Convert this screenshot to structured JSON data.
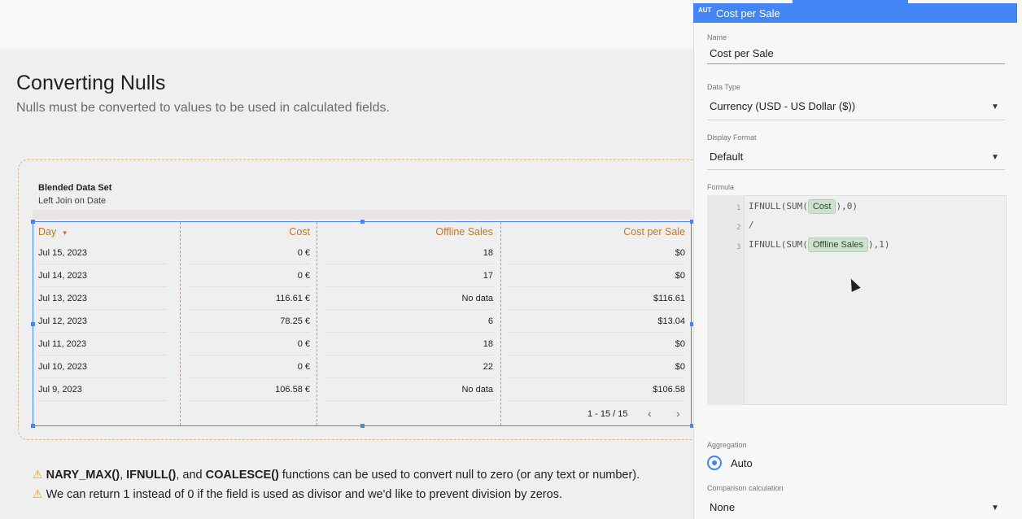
{
  "page": {
    "title": "Converting Nulls",
    "subtitle": "Nulls must be converted to values to be used in calculated fields."
  },
  "table": {
    "heading": "Blended Data Set",
    "subheading": "Left Join on Date",
    "columns": [
      "Day",
      "Cost",
      "Offline Sales",
      "Cost per Sale"
    ],
    "sort_icon": "sort-down-icon",
    "rows": [
      [
        "Jul 15, 2023",
        "0 €",
        "18",
        "$0"
      ],
      [
        "Jul 14, 2023",
        "0 €",
        "17",
        "$0"
      ],
      [
        "Jul 13, 2023",
        "116.61 €",
        "No data",
        "$116.61"
      ],
      [
        "Jul 12, 2023",
        "78.25 €",
        "6",
        "$13.04"
      ],
      [
        "Jul 11, 2023",
        "0 €",
        "18",
        "$0"
      ],
      [
        "Jul 10, 2023",
        "0 €",
        "22",
        "$0"
      ],
      [
        "Jul 9, 2023",
        "106.58 €",
        "No data",
        "$106.58"
      ]
    ],
    "pagination": "1 - 15 / 15",
    "prev": "‹",
    "next": "›"
  },
  "notes": {
    "warn_icon": "⚠",
    "line1_bold1": "NARY_MAX()",
    "line1_sep1": ", ",
    "line1_bold2": "IFNULL()",
    "line1_sep2": ", and ",
    "line1_bold3": "COALESCE()",
    "line1_rest": " functions can be used to convert null to zero (or any text or number).",
    "line2": "We can return 1 instead of 0 if the field is used as divisor and we'd like to prevent division by zeros."
  },
  "panel": {
    "badge": "AUT",
    "title": "Cost per Sale",
    "name_label": "Name",
    "name_value": "Cost per Sale",
    "data_type_label": "Data Type",
    "data_type_value": "Currency (USD - US Dollar ($))",
    "display_format_label": "Display Format",
    "display_format_value": "Default",
    "formula_label": "Formula",
    "formula_lines": [
      {
        "num": "1",
        "pre": "IFNULL(SUM(",
        "chip": "Cost",
        "post": "),0)"
      },
      {
        "num": "2",
        "pre": "/",
        "chip": "",
        "post": ""
      },
      {
        "num": "3",
        "pre": "IFNULL(SUM(",
        "chip": "Offline Sales",
        "post": "),1)"
      }
    ],
    "aggregation_label": "Aggregation",
    "aggregation_value": "Auto",
    "comparison_label": "Comparison calculation",
    "comparison_value": "None",
    "dropdown_glyph": "▼"
  },
  "colors": {
    "accent": "#4285f4",
    "header_text": "#b97a2c",
    "chip_bg": "#cfe1cf",
    "warn": "#e8a300"
  }
}
